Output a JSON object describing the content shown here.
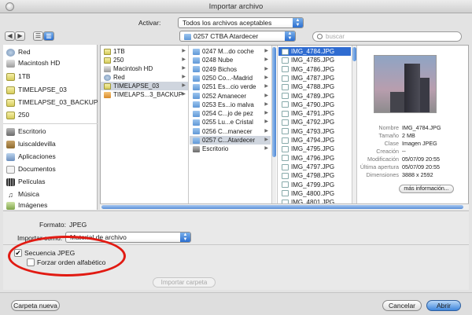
{
  "window": {
    "title": "Importar archivo"
  },
  "activar": {
    "label": "Activar:",
    "value": "Todos los archivos aceptables"
  },
  "location": {
    "value": "0257 CTBA Atardecer"
  },
  "search": {
    "placeholder": "buscar"
  },
  "sidebar": {
    "devices": [
      "Red",
      "Macintosh HD",
      "1TB",
      "TIMELAPSE_03",
      "TIMELAPSE_03_BACKUP",
      "250"
    ],
    "places": [
      "Escritorio",
      "luiscaldevilla",
      "Aplicaciones",
      "Documentos",
      "Películas",
      "Música",
      "Imágenes"
    ]
  },
  "columns": {
    "col1": [
      "1TB",
      "250",
      "Macintosh HD",
      "Red",
      "TIMELAPSE_03",
      "TIMELAPS...3_BACKUP"
    ],
    "col2": [
      "0247 M...do coche",
      "0248 Nube",
      "0249 Bichos",
      "0250 Co...-Madrid",
      "0251 Es...cio verde",
      "0252 Amanecer",
      "0253 Es...io malva",
      "0254 C...jo de pez",
      "0255 Lu...e Cristal",
      "0256 C...manecer",
      "0257 C...Atardecer",
      "Escritorio"
    ],
    "col3": [
      "IMG_4784.JPG",
      "IMG_4785.JPG",
      "IMG_4786.JPG",
      "IMG_4787.JPG",
      "IMG_4788.JPG",
      "IMG_4789.JPG",
      "IMG_4790.JPG",
      "IMG_4791.JPG",
      "IMG_4792.JPG",
      "IMG_4793.JPG",
      "IMG_4794.JPG",
      "IMG_4795.JPG",
      "IMG_4796.JPG",
      "IMG_4797.JPG",
      "IMG_4798.JPG",
      "IMG_4799.JPG",
      "IMG_4800.JPG",
      "IMG_4801.JPG"
    ]
  },
  "preview": {
    "fields": [
      {
        "k": "Nombre",
        "v": "IMG_4784.JPG"
      },
      {
        "k": "Tamaño",
        "v": "2 MB"
      },
      {
        "k": "Clase",
        "v": "Imagen JPEG"
      },
      {
        "k": "Creación",
        "v": "--"
      },
      {
        "k": "Modificación",
        "v": "05/07/09 20:55"
      },
      {
        "k": "Última apertura",
        "v": "05/07/09 20:55"
      },
      {
        "k": "Dimensiones",
        "v": "3888 x 2592"
      }
    ],
    "more_info": "más información..."
  },
  "options": {
    "formato_label": "Formato:",
    "formato_value": "JPEG",
    "importar_como_label": "Importar como:",
    "importar_como_value": "Material de archivo",
    "secuencia_label": "Secuencia JPEG",
    "secuencia_checked": true,
    "forzar_label": "Forzar orden alfabético",
    "forzar_checked": false,
    "importar_carpeta": "Importar carpeta"
  },
  "buttons": {
    "new_folder": "Carpeta nueva",
    "cancel": "Cancelar",
    "open": "Abrir"
  },
  "colors": {
    "selection": "#2f6cd1",
    "annotation": "#e11a12"
  }
}
